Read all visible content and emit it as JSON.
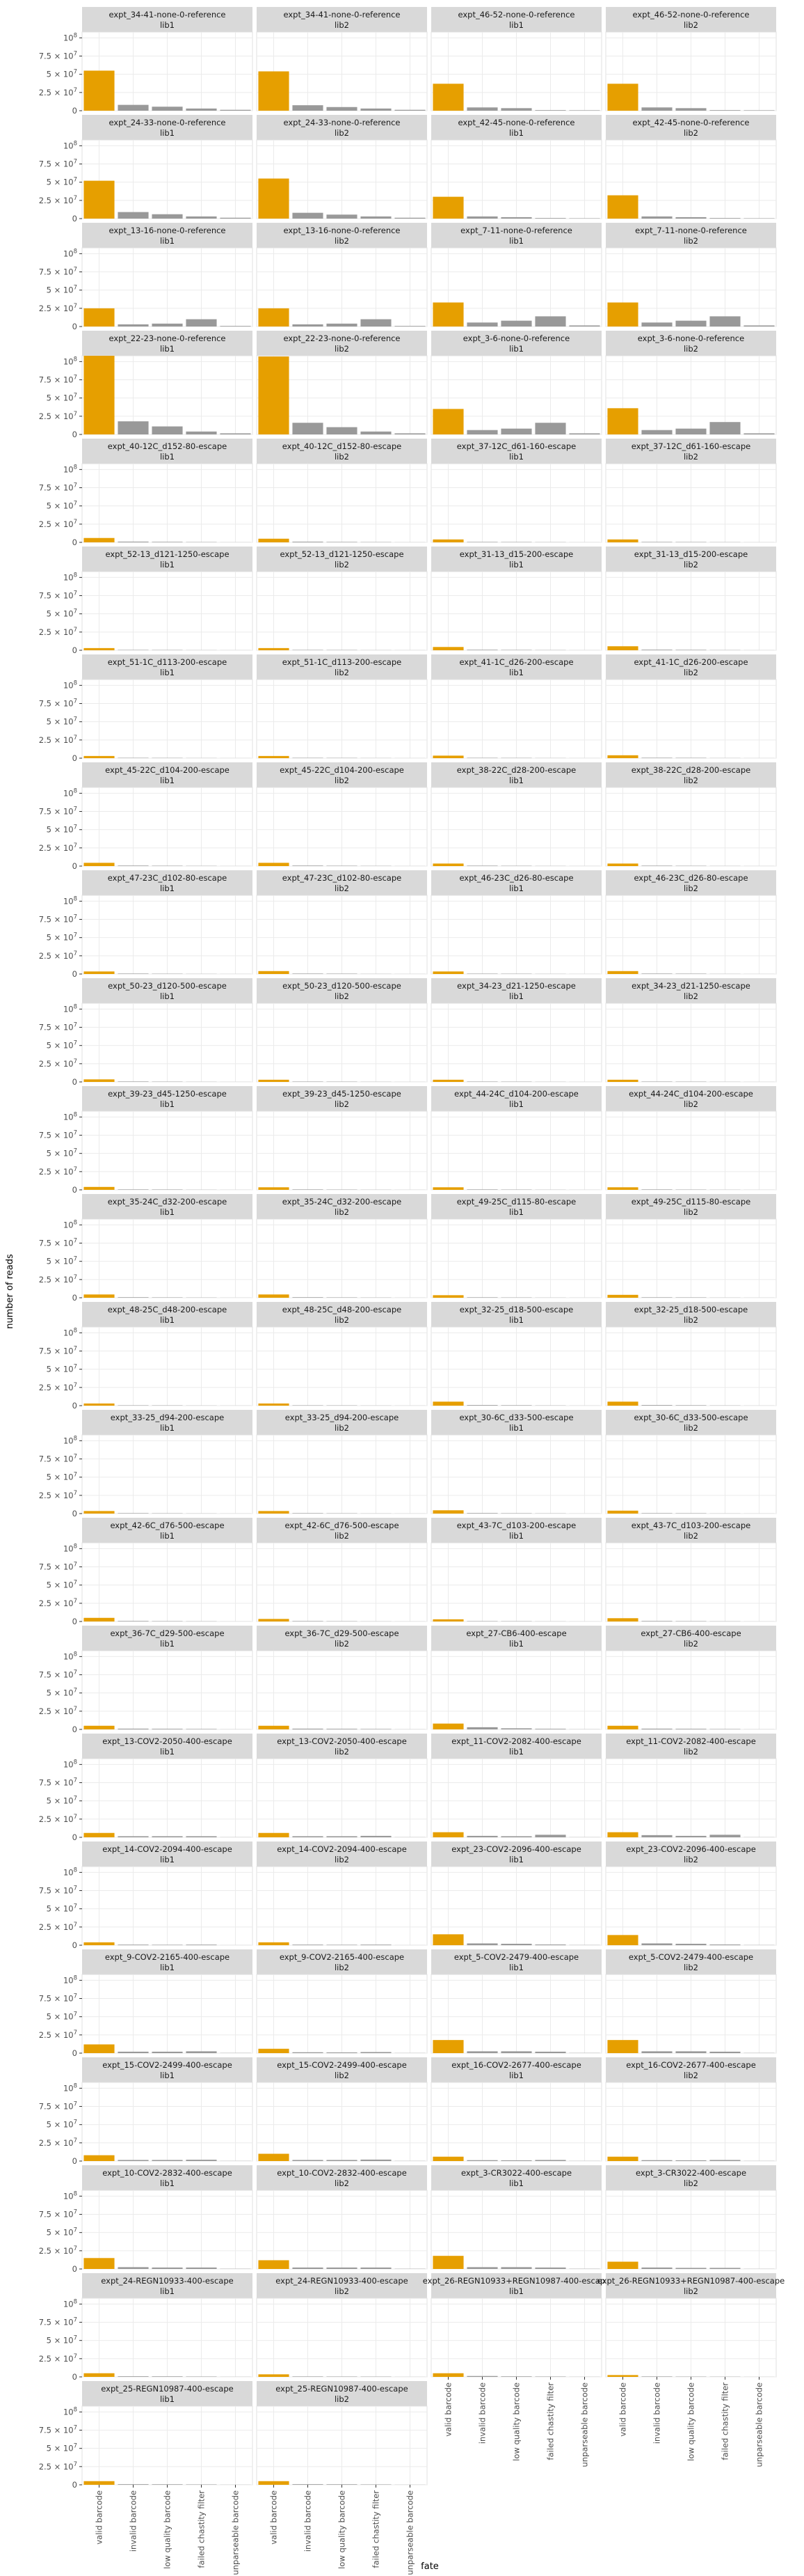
{
  "chart_data": {
    "type": "bar",
    "xlabel": "fate",
    "ylabel": "number of reads",
    "categories": [
      "valid barcode",
      "invalid barcode",
      "low quality barcode",
      "failed chastity filter",
      "unparseable barcode"
    ],
    "y_ticks": [
      {
        "value": 0,
        "label": "0"
      },
      {
        "value": 25000000,
        "label": "2.5 × 10^7"
      },
      {
        "value": 50000000,
        "label": "5 × 10^7"
      },
      {
        "value": 75000000,
        "label": "7.5 × 10^7"
      },
      {
        "value": 100000000,
        "label": "10^8"
      }
    ],
    "ylim": [
      0,
      108000000
    ],
    "colors": {
      "highlight": "#E69F00",
      "other": "#999999",
      "strip": "#D9D9D9",
      "grid": "#EBEBEB",
      "panel_border": "#E0E0E0"
    },
    "highlight_category": "valid barcode",
    "ncol": 4,
    "panels": [
      {
        "title": "expt_34-41-none-0-reference",
        "lib": "lib1",
        "values": [
          55000000,
          8000000,
          5500000,
          3000000,
          1200000
        ]
      },
      {
        "title": "expt_34-41-none-0-reference",
        "lib": "lib2",
        "values": [
          54000000,
          7500000,
          5000000,
          3000000,
          1200000
        ]
      },
      {
        "title": "expt_46-52-none-0-reference",
        "lib": "lib1",
        "values": [
          37000000,
          4500000,
          3500000,
          800000,
          600000
        ]
      },
      {
        "title": "expt_46-52-none-0-reference",
        "lib": "lib2",
        "values": [
          37000000,
          4500000,
          3500000,
          800000,
          600000
        ]
      },
      {
        "title": "expt_24-33-none-0-reference",
        "lib": "lib1",
        "values": [
          52000000,
          9000000,
          6000000,
          3000000,
          1200000
        ]
      },
      {
        "title": "expt_24-33-none-0-reference",
        "lib": "lib2",
        "values": [
          55000000,
          8000000,
          5500000,
          3000000,
          1200000
        ]
      },
      {
        "title": "expt_42-45-none-0-reference",
        "lib": "lib1",
        "values": [
          30000000,
          3000000,
          2000000,
          800000,
          500000
        ]
      },
      {
        "title": "expt_42-45-none-0-reference",
        "lib": "lib2",
        "values": [
          32000000,
          3000000,
          2000000,
          800000,
          500000
        ]
      },
      {
        "title": "expt_13-16-none-0-reference",
        "lib": "lib1",
        "values": [
          25000000,
          3000000,
          4000000,
          10000000,
          800000
        ]
      },
      {
        "title": "expt_13-16-none-0-reference",
        "lib": "lib2",
        "values": [
          25000000,
          3000000,
          4000000,
          10000000,
          800000
        ]
      },
      {
        "title": "expt_7-11-none-0-reference",
        "lib": "lib1",
        "values": [
          33000000,
          5500000,
          8000000,
          14000000,
          1500000
        ]
      },
      {
        "title": "expt_7-11-none-0-reference",
        "lib": "lib2",
        "values": [
          33000000,
          5500000,
          8000000,
          14000000,
          1500000
        ]
      },
      {
        "title": "expt_22-23-none-0-reference",
        "lib": "lib1",
        "values": [
          110000000,
          18000000,
          11000000,
          4000000,
          1500000
        ]
      },
      {
        "title": "expt_22-23-none-0-reference",
        "lib": "lib2",
        "values": [
          107000000,
          16000000,
          10000000,
          4000000,
          1500000
        ]
      },
      {
        "title": "expt_3-6-none-0-reference",
        "lib": "lib1",
        "values": [
          35000000,
          6000000,
          8000000,
          16000000,
          1500000
        ]
      },
      {
        "title": "expt_3-6-none-0-reference",
        "lib": "lib2",
        "values": [
          36000000,
          6000000,
          8000000,
          17000000,
          1500000
        ]
      },
      {
        "title": "expt_40-12C_d152-80-escape",
        "lib": "lib1",
        "values": [
          6000000,
          1000000,
          700000,
          400000,
          150000
        ]
      },
      {
        "title": "expt_40-12C_d152-80-escape",
        "lib": "lib2",
        "values": [
          5000000,
          900000,
          600000,
          400000,
          150000
        ]
      },
      {
        "title": "expt_37-12C_d61-160-escape",
        "lib": "lib1",
        "values": [
          4000000,
          600000,
          500000,
          300000,
          100000
        ]
      },
      {
        "title": "expt_37-12C_d61-160-escape",
        "lib": "lib2",
        "values": [
          4000000,
          600000,
          500000,
          300000,
          100000
        ]
      },
      {
        "title": "expt_52-13_d121-1250-escape",
        "lib": "lib1",
        "values": [
          3000000,
          500000,
          400000,
          200000,
          100000
        ]
      },
      {
        "title": "expt_52-13_d121-1250-escape",
        "lib": "lib2",
        "values": [
          3000000,
          500000,
          400000,
          200000,
          100000
        ]
      },
      {
        "title": "expt_31-13_d15-200-escape",
        "lib": "lib1",
        "values": [
          4500000,
          700000,
          500000,
          300000,
          100000
        ]
      },
      {
        "title": "expt_31-13_d15-200-escape",
        "lib": "lib2",
        "values": [
          5500000,
          800000,
          600000,
          300000,
          100000
        ]
      },
      {
        "title": "expt_51-1C_d113-200-escape",
        "lib": "lib1",
        "values": [
          3000000,
          500000,
          400000,
          200000,
          100000
        ]
      },
      {
        "title": "expt_51-1C_d113-200-escape",
        "lib": "lib2",
        "values": [
          3000000,
          500000,
          400000,
          200000,
          100000
        ]
      },
      {
        "title": "expt_41-1C_d26-200-escape",
        "lib": "lib1",
        "values": [
          3500000,
          500000,
          400000,
          200000,
          100000
        ]
      },
      {
        "title": "expt_41-1C_d26-200-escape",
        "lib": "lib2",
        "values": [
          4000000,
          600000,
          500000,
          200000,
          100000
        ]
      },
      {
        "title": "expt_45-22C_d104-200-escape",
        "lib": "lib1",
        "values": [
          4500000,
          700000,
          500000,
          300000,
          100000
        ]
      },
      {
        "title": "expt_45-22C_d104-200-escape",
        "lib": "lib2",
        "values": [
          4500000,
          700000,
          500000,
          300000,
          100000
        ]
      },
      {
        "title": "expt_38-22C_d28-200-escape",
        "lib": "lib1",
        "values": [
          3500000,
          600000,
          400000,
          200000,
          100000
        ]
      },
      {
        "title": "expt_38-22C_d28-200-escape",
        "lib": "lib2",
        "values": [
          3500000,
          600000,
          400000,
          200000,
          100000
        ]
      },
      {
        "title": "expt_47-23C_d102-80-escape",
        "lib": "lib1",
        "values": [
          3500000,
          600000,
          400000,
          200000,
          100000
        ]
      },
      {
        "title": "expt_47-23C_d102-80-escape",
        "lib": "lib2",
        "values": [
          4000000,
          600000,
          500000,
          200000,
          100000
        ]
      },
      {
        "title": "expt_46-23C_d26-80-escape",
        "lib": "lib1",
        "values": [
          3500000,
          500000,
          400000,
          200000,
          100000
        ]
      },
      {
        "title": "expt_46-23C_d26-80-escape",
        "lib": "lib2",
        "values": [
          4000000,
          600000,
          500000,
          200000,
          100000
        ]
      },
      {
        "title": "expt_50-23_d120-500-escape",
        "lib": "lib1",
        "values": [
          3500000,
          600000,
          400000,
          200000,
          100000
        ]
      },
      {
        "title": "expt_50-23_d120-500-escape",
        "lib": "lib2",
        "values": [
          3000000,
          500000,
          400000,
          200000,
          100000
        ]
      },
      {
        "title": "expt_34-23_d21-1250-escape",
        "lib": "lib1",
        "values": [
          3000000,
          500000,
          400000,
          200000,
          100000
        ]
      },
      {
        "title": "expt_34-23_d21-1250-escape",
        "lib": "lib2",
        "values": [
          3000000,
          500000,
          400000,
          200000,
          100000
        ]
      },
      {
        "title": "expt_39-23_d45-1250-escape",
        "lib": "lib1",
        "values": [
          4000000,
          600000,
          500000,
          200000,
          100000
        ]
      },
      {
        "title": "expt_39-23_d45-1250-escape",
        "lib": "lib2",
        "values": [
          3500000,
          600000,
          400000,
          200000,
          100000
        ]
      },
      {
        "title": "expt_44-24C_d104-200-escape",
        "lib": "lib1",
        "values": [
          3500000,
          600000,
          400000,
          200000,
          100000
        ]
      },
      {
        "title": "expt_44-24C_d104-200-escape",
        "lib": "lib2",
        "values": [
          3500000,
          600000,
          400000,
          200000,
          100000
        ]
      },
      {
        "title": "expt_35-24C_d32-200-escape",
        "lib": "lib1",
        "values": [
          4500000,
          700000,
          500000,
          300000,
          100000
        ]
      },
      {
        "title": "expt_35-24C_d32-200-escape",
        "lib": "lib2",
        "values": [
          4500000,
          700000,
          500000,
          300000,
          100000
        ]
      },
      {
        "title": "expt_49-25C_d115-80-escape",
        "lib": "lib1",
        "values": [
          3500000,
          600000,
          400000,
          200000,
          100000
        ]
      },
      {
        "title": "expt_49-25C_d115-80-escape",
        "lib": "lib2",
        "values": [
          4000000,
          600000,
          500000,
          200000,
          100000
        ]
      },
      {
        "title": "expt_48-25C_d48-200-escape",
        "lib": "lib1",
        "values": [
          3000000,
          500000,
          400000,
          200000,
          100000
        ]
      },
      {
        "title": "expt_48-25C_d48-200-escape",
        "lib": "lib2",
        "values": [
          3000000,
          500000,
          400000,
          200000,
          100000
        ]
      },
      {
        "title": "expt_32-25_d18-500-escape",
        "lib": "lib1",
        "values": [
          5500000,
          800000,
          600000,
          300000,
          100000
        ]
      },
      {
        "title": "expt_32-25_d18-500-escape",
        "lib": "lib2",
        "values": [
          5500000,
          800000,
          600000,
          300000,
          100000
        ]
      },
      {
        "title": "expt_33-25_d94-200-escape",
        "lib": "lib1",
        "values": [
          3500000,
          600000,
          400000,
          200000,
          100000
        ]
      },
      {
        "title": "expt_33-25_d94-200-escape",
        "lib": "lib2",
        "values": [
          3500000,
          600000,
          400000,
          200000,
          100000
        ]
      },
      {
        "title": "expt_30-6C_d33-500-escape",
        "lib": "lib1",
        "values": [
          4500000,
          700000,
          500000,
          300000,
          100000
        ]
      },
      {
        "title": "expt_30-6C_d33-500-escape",
        "lib": "lib2",
        "values": [
          4000000,
          600000,
          500000,
          200000,
          100000
        ]
      },
      {
        "title": "expt_42-6C_d76-500-escape",
        "lib": "lib1",
        "values": [
          5000000,
          700000,
          500000,
          300000,
          100000
        ]
      },
      {
        "title": "expt_42-6C_d76-500-escape",
        "lib": "lib2",
        "values": [
          3500000,
          600000,
          400000,
          200000,
          100000
        ]
      },
      {
        "title": "expt_43-7C_d103-200-escape",
        "lib": "lib1",
        "values": [
          3000000,
          500000,
          400000,
          200000,
          100000
        ]
      },
      {
        "title": "expt_43-7C_d103-200-escape",
        "lib": "lib2",
        "values": [
          4500000,
          700000,
          500000,
          300000,
          100000
        ]
      },
      {
        "title": "expt_36-7C_d29-500-escape",
        "lib": "lib1",
        "values": [
          5000000,
          1000000,
          800000,
          600000,
          150000
        ]
      },
      {
        "title": "expt_36-7C_d29-500-escape",
        "lib": "lib2",
        "values": [
          5000000,
          1000000,
          800000,
          600000,
          150000
        ]
      },
      {
        "title": "expt_27-CB6-400-escape",
        "lib": "lib1",
        "values": [
          8000000,
          3000000,
          1500000,
          800000,
          200000
        ]
      },
      {
        "title": "expt_27-CB6-400-escape",
        "lib": "lib2",
        "values": [
          5000000,
          1000000,
          800000,
          500000,
          150000
        ]
      },
      {
        "title": "expt_13-COV2-2050-400-escape",
        "lib": "lib1",
        "values": [
          6000000,
          1500000,
          1500000,
          1500000,
          200000
        ]
      },
      {
        "title": "expt_13-COV2-2050-400-escape",
        "lib": "lib2",
        "values": [
          6000000,
          1500000,
          1500000,
          2000000,
          200000
        ]
      },
      {
        "title": "expt_11-COV2-2082-400-escape",
        "lib": "lib1",
        "values": [
          7000000,
          2000000,
          1500000,
          3500000,
          200000
        ]
      },
      {
        "title": "expt_11-COV2-2082-400-escape",
        "lib": "lib2",
        "values": [
          7000000,
          3000000,
          2000000,
          3500000,
          200000
        ]
      },
      {
        "title": "expt_14-COV2-2094-400-escape",
        "lib": "lib1",
        "values": [
          4000000,
          800000,
          600000,
          800000,
          100000
        ]
      },
      {
        "title": "expt_14-COV2-2094-400-escape",
        "lib": "lib2",
        "values": [
          4000000,
          800000,
          600000,
          800000,
          100000
        ]
      },
      {
        "title": "expt_23-COV2-2096-400-escape",
        "lib": "lib1",
        "values": [
          15000000,
          2500000,
          2000000,
          1000000,
          300000
        ]
      },
      {
        "title": "expt_23-COV2-2096-400-escape",
        "lib": "lib2",
        "values": [
          14000000,
          2500000,
          2000000,
          1000000,
          300000
        ]
      },
      {
        "title": "expt_9-COV2-2165-400-escape",
        "lib": "lib1",
        "values": [
          12000000,
          2000000,
          2000000,
          2500000,
          300000
        ]
      },
      {
        "title": "expt_9-COV2-2165-400-escape",
        "lib": "lib2",
        "values": [
          6000000,
          1200000,
          1000000,
          1500000,
          200000
        ]
      },
      {
        "title": "expt_5-COV2-2479-400-escape",
        "lib": "lib1",
        "values": [
          18000000,
          2500000,
          2500000,
          2000000,
          300000
        ]
      },
      {
        "title": "expt_5-COV2-2479-400-escape",
        "lib": "lib2",
        "values": [
          18000000,
          2500000,
          2500000,
          2000000,
          300000
        ]
      },
      {
        "title": "expt_15-COV2-2499-400-escape",
        "lib": "lib1",
        "values": [
          8000000,
          1500000,
          1500000,
          1800000,
          200000
        ]
      },
      {
        "title": "expt_15-COV2-2499-400-escape",
        "lib": "lib2",
        "values": [
          10000000,
          1500000,
          1500000,
          2000000,
          200000
        ]
      },
      {
        "title": "expt_16-COV2-2677-400-escape",
        "lib": "lib1",
        "values": [
          6000000,
          1200000,
          1000000,
          1500000,
          200000
        ]
      },
      {
        "title": "expt_16-COV2-2677-400-escape",
        "lib": "lib2",
        "values": [
          6000000,
          1200000,
          1000000,
          1500000,
          200000
        ]
      },
      {
        "title": "expt_10-COV2-2832-400-escape",
        "lib": "lib1",
        "values": [
          15000000,
          2500000,
          2000000,
          2000000,
          300000
        ]
      },
      {
        "title": "expt_10-COV2-2832-400-escape",
        "lib": "lib2",
        "values": [
          12000000,
          2000000,
          2000000,
          2000000,
          300000
        ]
      },
      {
        "title": "expt_3-CR3022-400-escape",
        "lib": "lib1",
        "values": [
          18000000,
          2500000,
          2500000,
          2000000,
          300000
        ]
      },
      {
        "title": "expt_3-CR3022-400-escape",
        "lib": "lib2",
        "values": [
          10000000,
          2000000,
          1500000,
          1500000,
          200000
        ]
      },
      {
        "title": "expt_24-REGN10933-400-escape",
        "lib": "lib1",
        "values": [
          5000000,
          800000,
          700000,
          500000,
          150000
        ]
      },
      {
        "title": "expt_24-REGN10933-400-escape",
        "lib": "lib2",
        "values": [
          3500000,
          600000,
          500000,
          400000,
          100000
        ]
      },
      {
        "title": "expt_26-REGN10933+REGN10987-400-escape",
        "lib": "lib1",
        "values": [
          5000000,
          1200000,
          700000,
          500000,
          150000
        ]
      },
      {
        "title": "expt_26-REGN10933+REGN10987-400-escape",
        "lib": "lib2",
        "values": [
          2500000,
          600000,
          400000,
          300000,
          100000
        ]
      },
      {
        "title": "expt_25-REGN10987-400-escape",
        "lib": "lib1",
        "values": [
          5000000,
          800000,
          700000,
          500000,
          150000
        ]
      },
      {
        "title": "expt_25-REGN10987-400-escape",
        "lib": "lib2",
        "values": [
          5000000,
          800000,
          700000,
          500000,
          150000
        ]
      }
    ]
  }
}
